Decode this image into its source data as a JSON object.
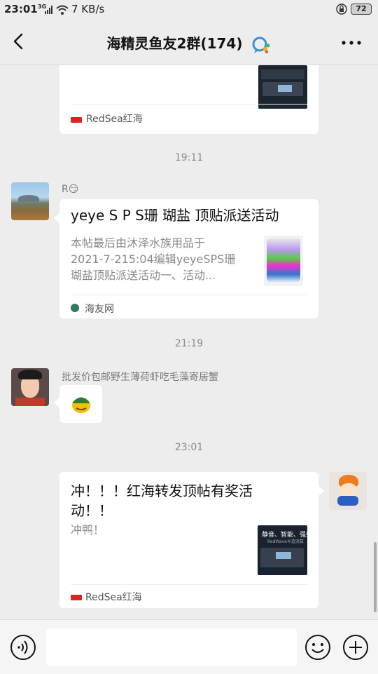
{
  "status_bar": {
    "time": "23:01",
    "signal_label": "3G",
    "speed": "7 KB/s",
    "battery": "72"
  },
  "header": {
    "title": "海精灵鱼友2群(174)"
  },
  "messages": {
    "card1": {
      "source": "RedSea红海"
    },
    "time1": "19:11",
    "msg2": {
      "sender": "R😏",
      "title": "yeye S P S珊 瑚盐 顶贴派送活动",
      "desc_line1": "本帖最后由沐泽水族用品于",
      "desc_line2": "2021-7-215:04编辑yeyeSPS珊",
      "desc_line3": "瑚盐顶贴派送活动一、活动...",
      "source": "海友网"
    },
    "time2": "21:19",
    "msg3": {
      "sender": "批发价包邮野生薄荷虾吃毛藻寄居蟹"
    },
    "time3": "23:01",
    "msg4": {
      "title": "冲！！！红海转发顶帖有奖活动！！",
      "desc": "冲鸭！",
      "thumb_text1": "静音、智能、强劲",
      "thumb_text2": "RedWave®造流泵",
      "source": "RedSea红海"
    }
  },
  "input": {
    "placeholder": ""
  },
  "colors": {
    "background": "#ededed",
    "bubble": "#ffffff",
    "muted_text": "#8a8a8a"
  }
}
